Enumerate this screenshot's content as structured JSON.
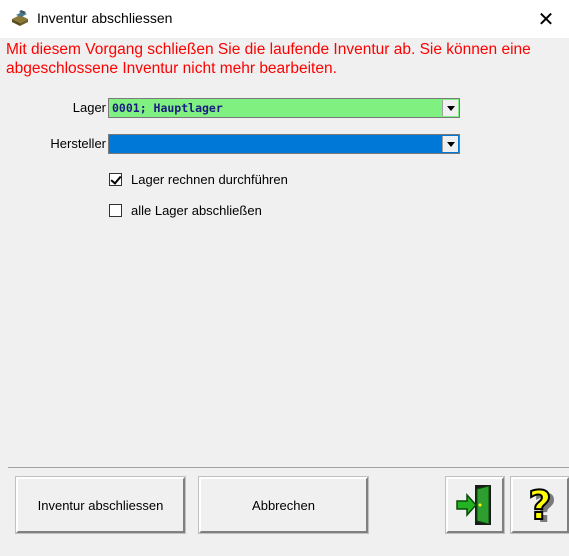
{
  "window": {
    "title": "Inventur abschliessen",
    "close_symbol": "✕"
  },
  "warning_text": "Mit diesem Vorgang schließen Sie die laufende Inventur ab. Sie können eine abgeschlossene Inventur nicht mehr bearbeiten.",
  "form": {
    "lager": {
      "label": "Lager",
      "value": "0001; Hauptlager",
      "color": "#80f080"
    },
    "hersteller": {
      "label": "Hersteller",
      "value": "",
      "color": "#0078d7"
    },
    "checkboxes": [
      {
        "label": "Lager rechnen  durchführen",
        "checked": true
      },
      {
        "label": "alle Lager abschließen",
        "checked": false
      }
    ]
  },
  "buttons": {
    "finish_label": "Inventur abschliessen",
    "cancel_label": "Abbrechen",
    "exit_icon": "exit-door-icon",
    "help_icon": "help-question-icon"
  },
  "colors": {
    "warning": "#ff0000",
    "accent_blue": "#0078d7",
    "lager_green": "#80f080"
  }
}
